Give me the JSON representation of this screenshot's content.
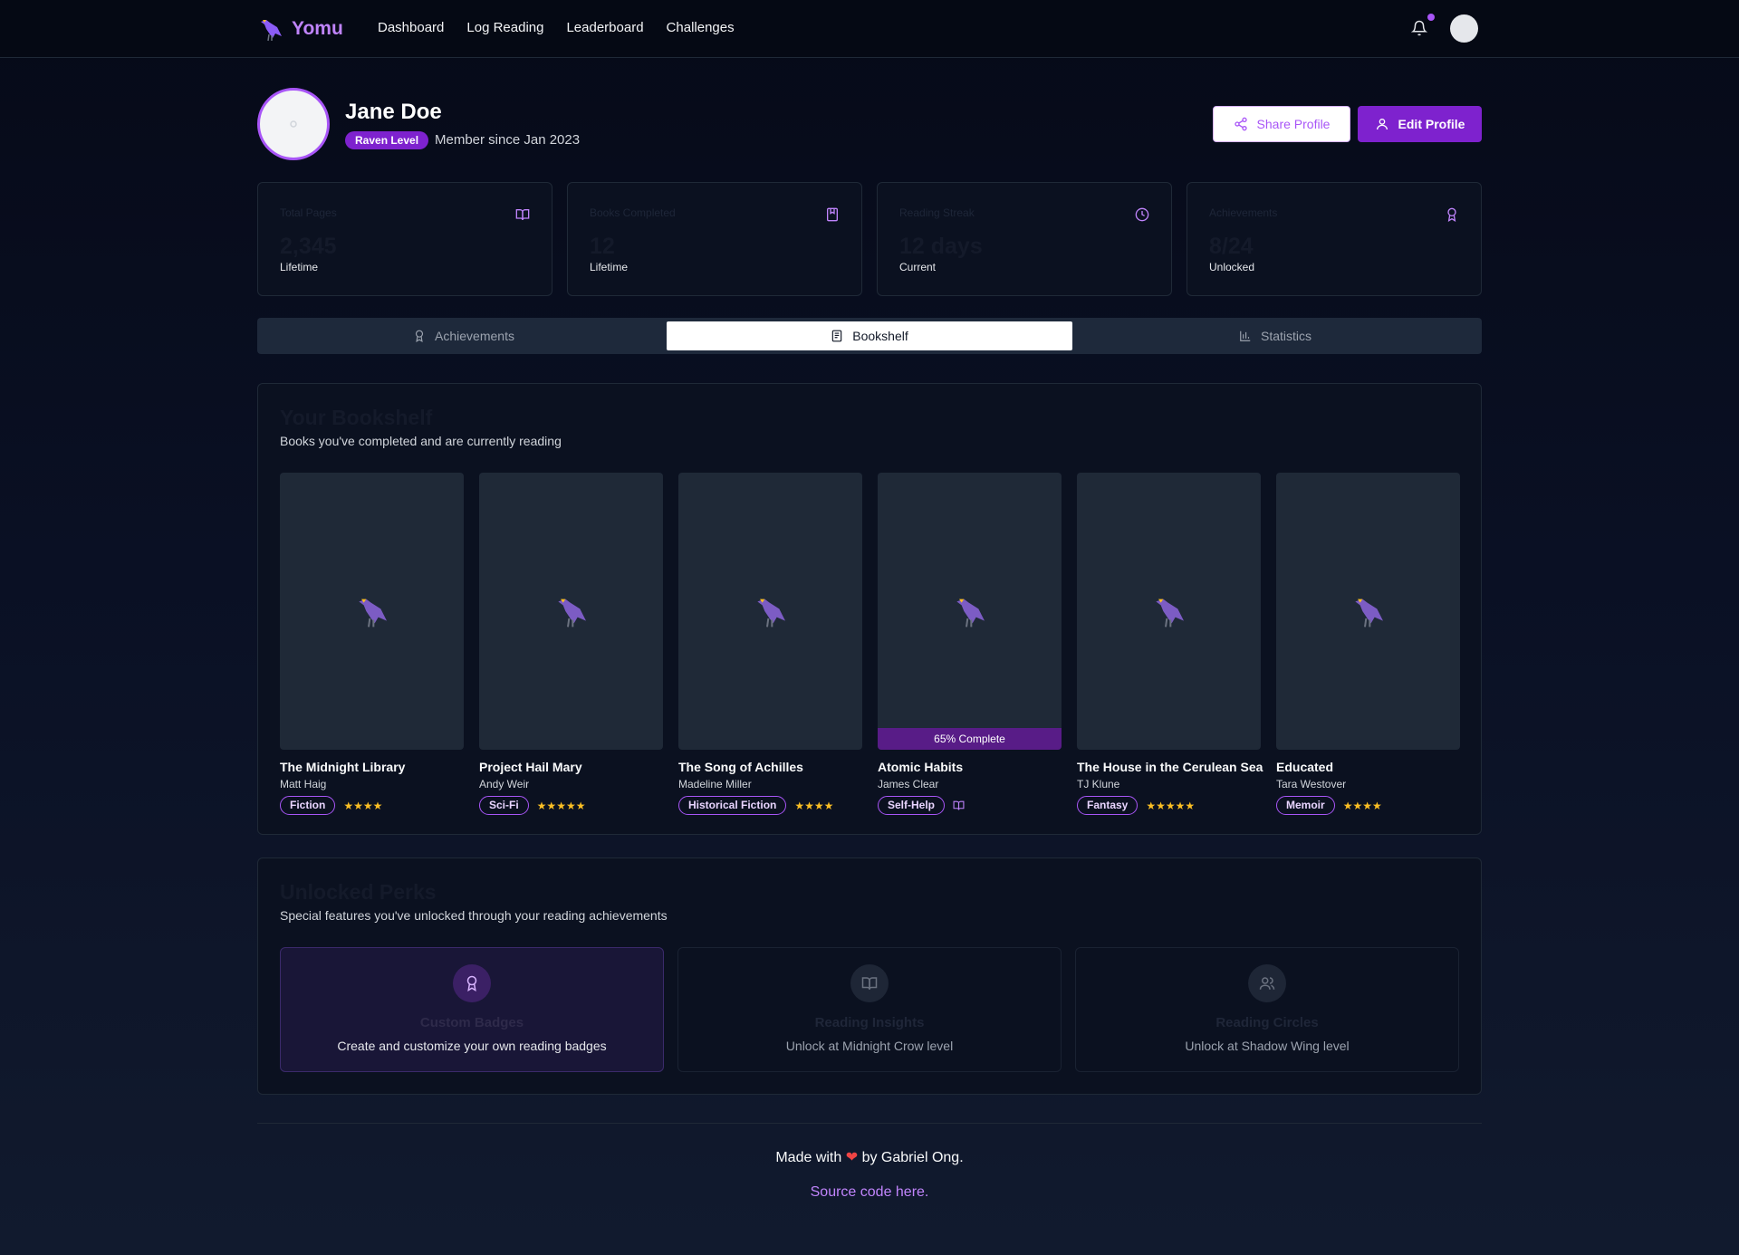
{
  "nav": {
    "brand": "Yomu",
    "links": [
      "Dashboard",
      "Log Reading",
      "Leaderboard",
      "Challenges"
    ]
  },
  "profile": {
    "name": "Jane Doe",
    "level": "Raven Level",
    "member_since": "Member since Jan 2023",
    "share_label": "Share Profile",
    "edit_label": "Edit Profile"
  },
  "stats": [
    {
      "title": "Total Pages",
      "value": "2,345",
      "sub": "Lifetime",
      "icon": "book-open-icon"
    },
    {
      "title": "Books Completed",
      "value": "12",
      "sub": "Lifetime",
      "icon": "book-icon"
    },
    {
      "title": "Reading Streak",
      "value": "12 days",
      "sub": "Current",
      "icon": "clock-icon"
    },
    {
      "title": "Achievements",
      "value": "8/24",
      "sub": "Unlocked",
      "icon": "award-icon"
    }
  ],
  "tabs": [
    {
      "label": "Achievements",
      "icon": "award-icon"
    },
    {
      "label": "Bookshelf",
      "icon": "book-icon",
      "active": true
    },
    {
      "label": "Statistics",
      "icon": "bar-chart-icon"
    }
  ],
  "bookshelf": {
    "title": "Your Bookshelf",
    "subtitle": "Books you've completed and are currently reading",
    "books": [
      {
        "title": "The Midnight Library",
        "author": "Matt Haig",
        "genre": "Fiction",
        "stars": "★★★★"
      },
      {
        "title": "Project Hail Mary",
        "author": "Andy Weir",
        "genre": "Sci-Fi",
        "stars": "★★★★★"
      },
      {
        "title": "The Song of Achilles",
        "author": "Madeline Miller",
        "genre": "Historical Fiction",
        "stars": "★★★★"
      },
      {
        "title": "Atomic Habits",
        "author": "James Clear",
        "genre": "Self-Help",
        "progress": "65% Complete",
        "progress_fraction": 0.65
      },
      {
        "title": "The House in the Cerulean Sea",
        "author": "TJ Klune",
        "genre": "Fantasy",
        "stars": "★★★★★"
      },
      {
        "title": "Educated",
        "author": "Tara Westover",
        "genre": "Memoir",
        "stars": "★★★★"
      }
    ]
  },
  "perks": {
    "title": "Unlocked Perks",
    "subtitle": "Special features you've unlocked through your reading achievements",
    "items": [
      {
        "title": "Custom Badges",
        "desc": "Create and customize your own reading badges",
        "icon": "award-icon",
        "unlocked": true
      },
      {
        "title": "Reading Insights",
        "desc": "Unlock at Midnight Crow level",
        "icon": "book-open-icon",
        "unlocked": false
      },
      {
        "title": "Reading Circles",
        "desc": "Unlock at Shadow Wing level",
        "icon": "users-icon",
        "unlocked": false
      }
    ]
  },
  "footer": {
    "made_with_prefix": "Made with",
    "made_with_suffix": "by Gabriel Ong.",
    "source_link": "Source code here."
  },
  "colors": {
    "accent": "#7e22ce",
    "accent_light": "#c084fc",
    "star": "#fbbf24"
  }
}
